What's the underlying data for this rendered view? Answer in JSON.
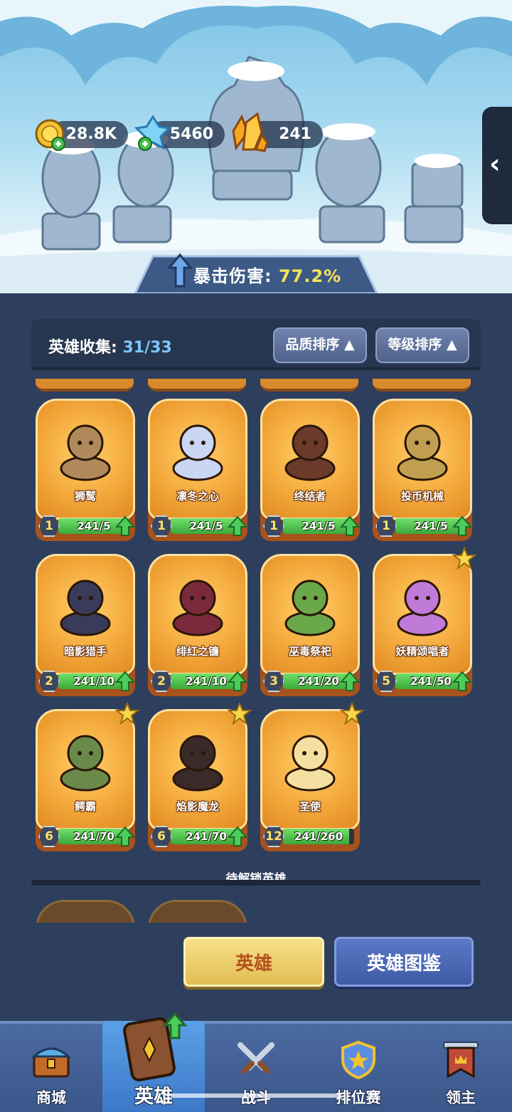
{
  "resources": [
    {
      "name": "gold",
      "value": "28.8K",
      "icon": "gold-coin-icon"
    },
    {
      "name": "crystal",
      "value": "5460",
      "icon": "blue-crystal-icon"
    },
    {
      "name": "amber",
      "value": "241",
      "icon": "amber-crystal-icon"
    }
  ],
  "crit": {
    "label": "暴击伤害:",
    "value": "77.2%"
  },
  "collection": {
    "label": "英雄收集:",
    "count": "31/33"
  },
  "sort": {
    "quality": "品质排序",
    "level": "等级排序"
  },
  "heroes": [
    {
      "name": "狮鹫",
      "level": "1",
      "progress": "241/5",
      "fill": 1.0,
      "star": false
    },
    {
      "name": "凛冬之心",
      "level": "1",
      "progress": "241/5",
      "fill": 1.0,
      "star": false
    },
    {
      "name": "终结者",
      "level": "1",
      "progress": "241/5",
      "fill": 1.0,
      "star": false
    },
    {
      "name": "投币机械",
      "level": "1",
      "progress": "241/5",
      "fill": 1.0,
      "star": false
    },
    {
      "name": "暗影猎手",
      "level": "2",
      "progress": "241/10",
      "fill": 1.0,
      "star": false
    },
    {
      "name": "绯红之镰",
      "level": "2",
      "progress": "241/10",
      "fill": 1.0,
      "star": false
    },
    {
      "name": "巫毒祭祀",
      "level": "3",
      "progress": "241/20",
      "fill": 1.0,
      "star": false
    },
    {
      "name": "妖精颂唱者",
      "level": "5",
      "progress": "241/50",
      "fill": 1.0,
      "star": true
    },
    {
      "name": "鳄霸",
      "level": "6",
      "progress": "241/70",
      "fill": 1.0,
      "star": true
    },
    {
      "name": "焰影魔龙",
      "level": "6",
      "progress": "241/70",
      "fill": 1.0,
      "star": true
    },
    {
      "name": "圣使",
      "level": "12",
      "progress": "241/260",
      "fill": 0.93,
      "star": true
    }
  ],
  "locked_section": "待解锁英雄",
  "buttons": {
    "hero": "英雄",
    "codex": "英雄图鉴"
  },
  "nav": [
    {
      "label": "商城",
      "icon": "chest-icon"
    },
    {
      "label": "英雄",
      "icon": "hero-card-icon"
    },
    {
      "label": "战斗",
      "icon": "crossed-swords-icon"
    },
    {
      "label": "排位赛",
      "icon": "ranking-shield-icon"
    },
    {
      "label": "领主",
      "icon": "banner-icon"
    }
  ],
  "colors": {
    "accent_gold": "#f6e25a",
    "progress_green": "#4cc44a",
    "card_orange": "#f4a93c",
    "nav_blue": "#4b6aa0"
  }
}
